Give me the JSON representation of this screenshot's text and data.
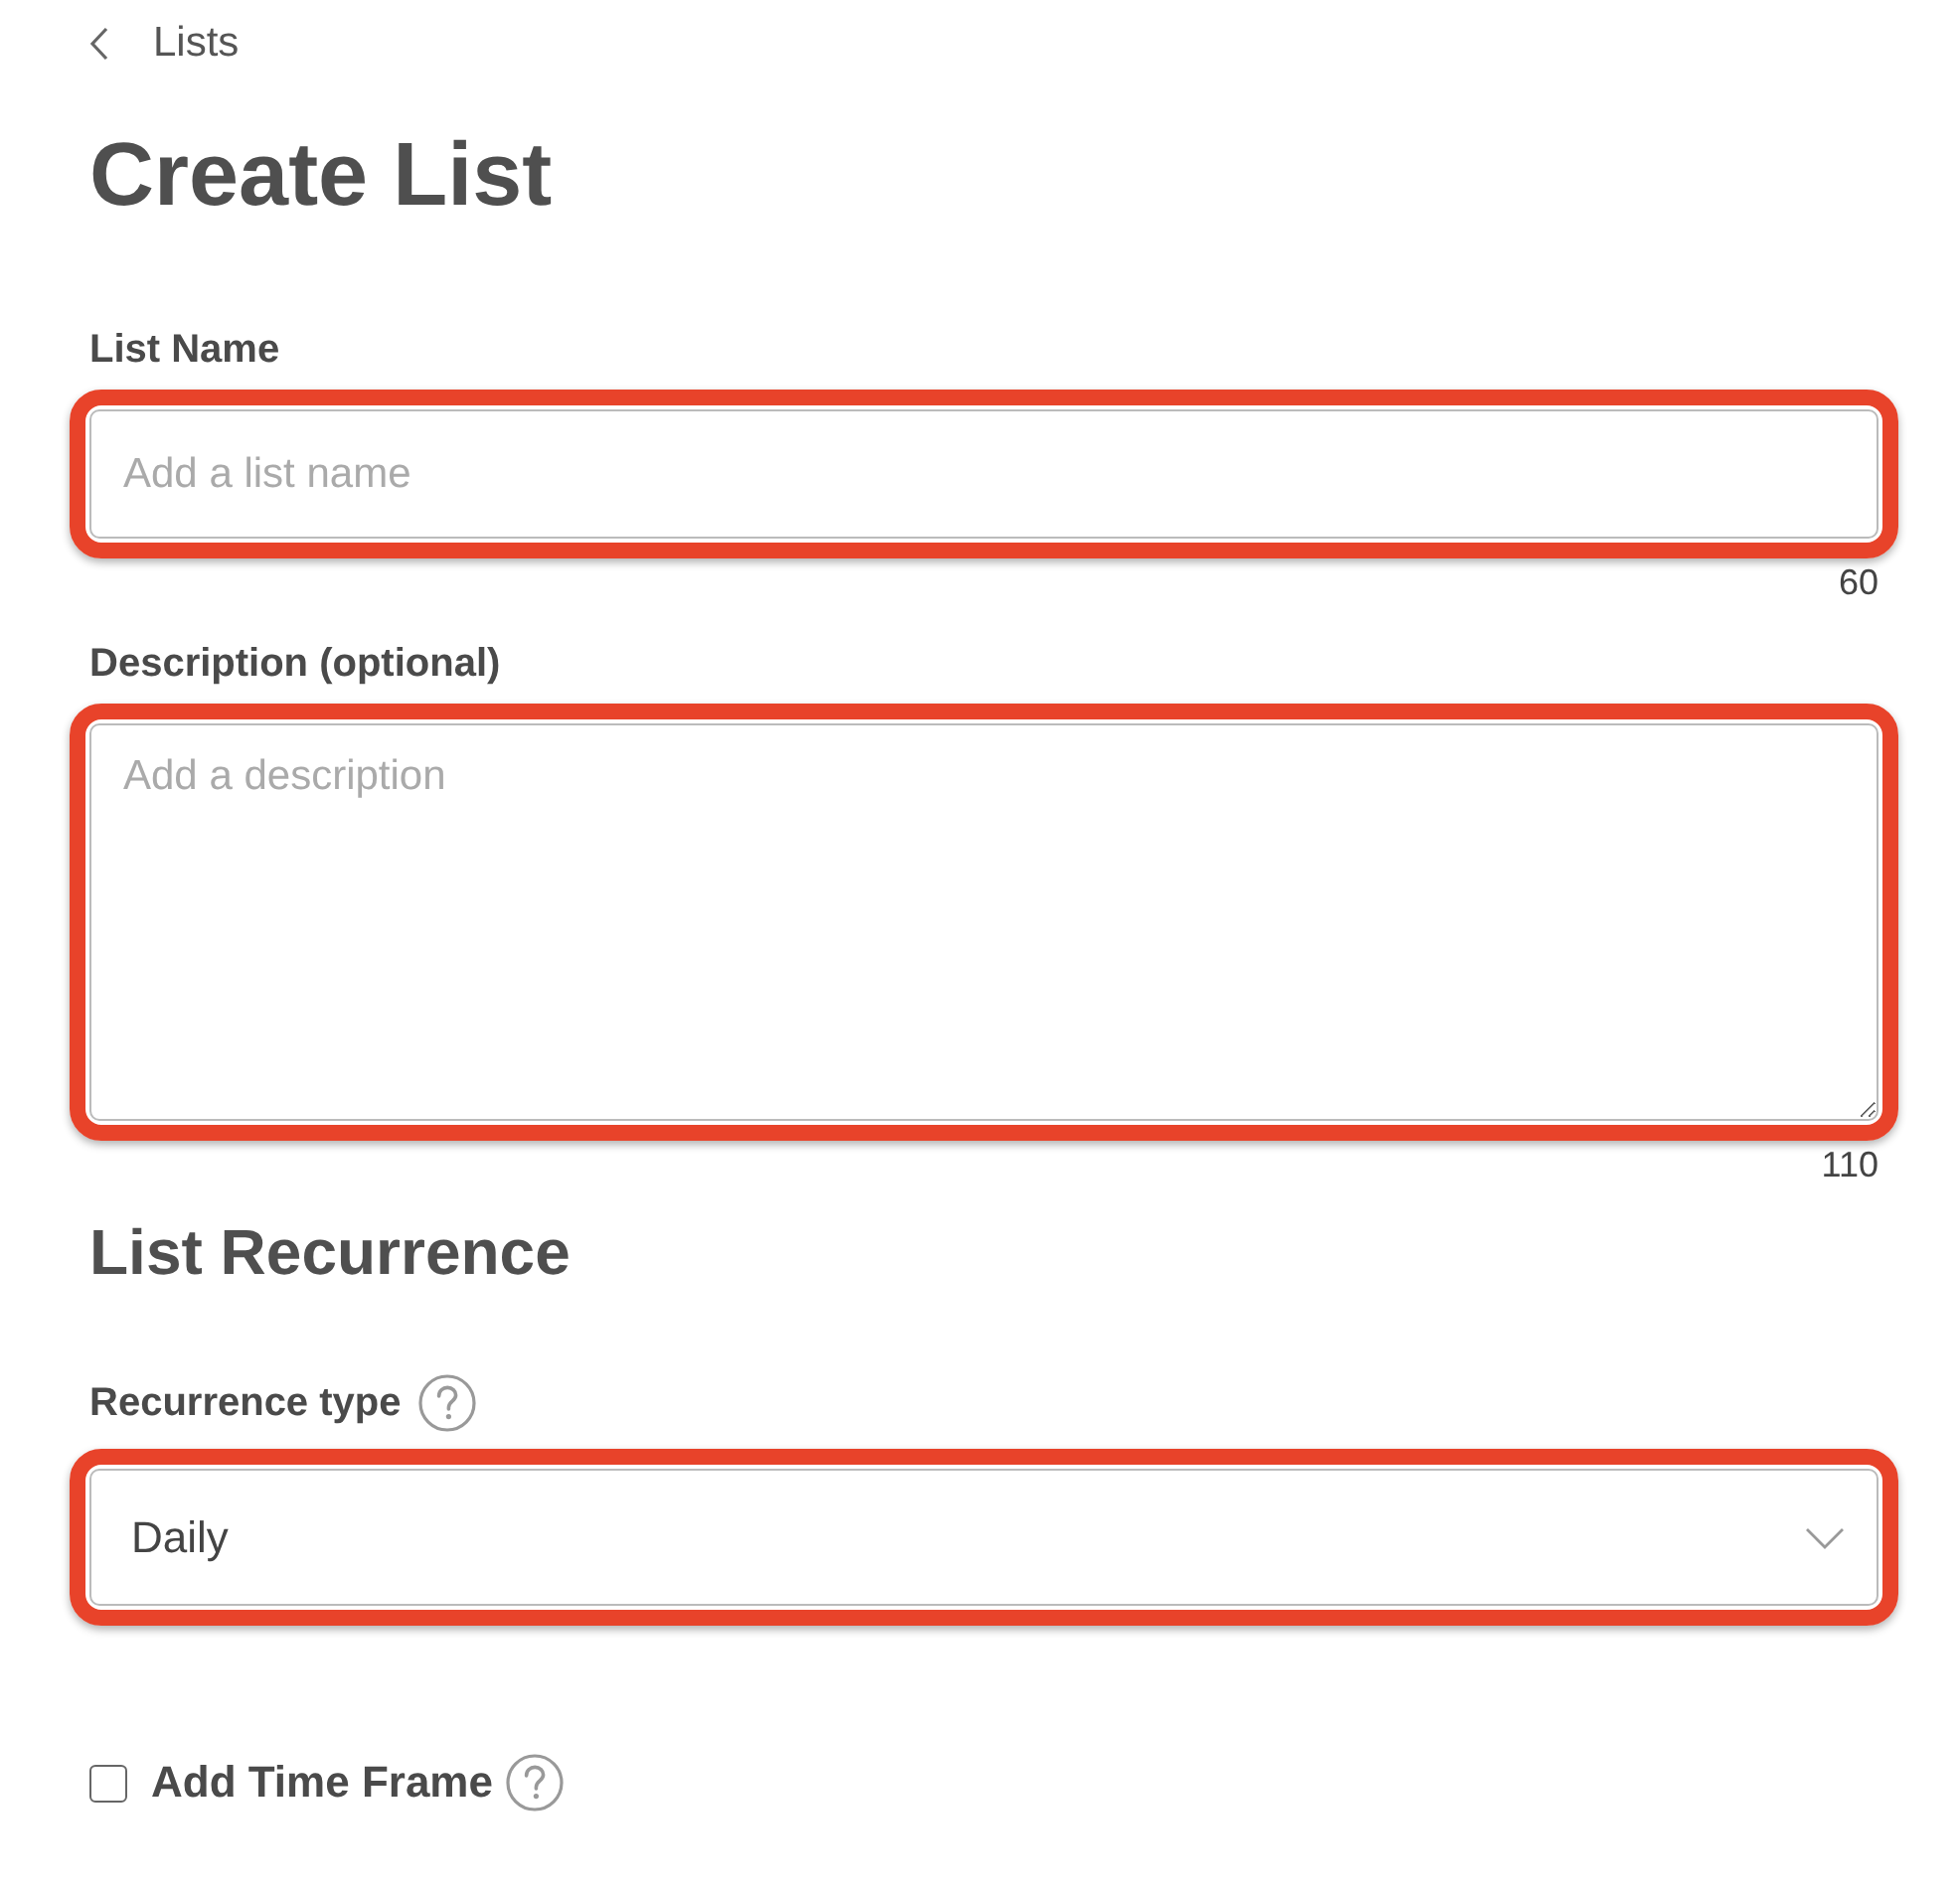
{
  "back_link": {
    "label": "Lists"
  },
  "title": "Create List",
  "fields": [
    {
      "kind": "text",
      "label": "List Name",
      "placeholder": "Add a list name",
      "counter": "60",
      "highlighted": true
    },
    {
      "kind": "textarea",
      "label": "Description (optional)",
      "placeholder": "Add a description",
      "counter": "110",
      "highlighted": true
    }
  ],
  "section_title": "List Recurrence",
  "recurrence": {
    "label": "Recurrence type",
    "value": "Daily",
    "highlighted": true
  },
  "time_frame": {
    "label": "Add Time Frame",
    "checked": false
  }
}
